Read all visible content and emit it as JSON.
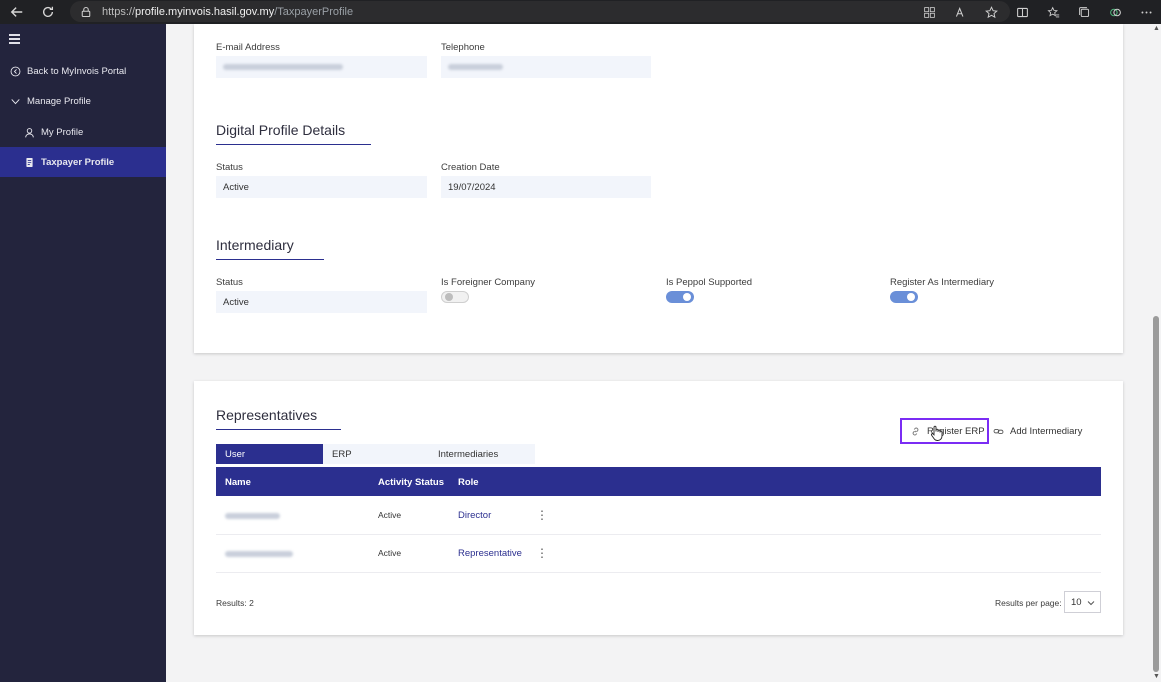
{
  "browser": {
    "url_prefix": "https://",
    "url_domain": "profile.myinvois.hasil.gov.my",
    "url_path": "/TaxpayerProfile"
  },
  "sidebar": {
    "items": [
      {
        "label": "Back to MyInvois Portal",
        "icon": "arrow-circle-left-icon"
      },
      {
        "label": "Manage Profile",
        "icon": "chevron-down-icon"
      },
      {
        "label": "My Profile",
        "icon": "user-icon"
      },
      {
        "label": "Taxpayer Profile",
        "icon": "document-icon",
        "active": true
      }
    ]
  },
  "contact": {
    "email_label": "E-mail Address",
    "telephone_label": "Telephone"
  },
  "digital_profile": {
    "title": "Digital Profile Details",
    "status_label": "Status",
    "status_value": "Active",
    "creation_date_label": "Creation Date",
    "creation_date_value": "19/07/2024"
  },
  "intermediary": {
    "title": "Intermediary",
    "status_label": "Status",
    "status_value": "Active",
    "foreigner_label": "Is Foreigner Company",
    "foreigner_on": false,
    "peppol_label": "Is Peppol Supported",
    "peppol_on": true,
    "register_label": "Register As Intermediary",
    "register_on": true
  },
  "representatives": {
    "title": "Representatives",
    "register_erp_label": "Register ERP",
    "add_intermediary_label": "Add Intermediary",
    "tabs": [
      "User",
      "ERP",
      "Intermediaries"
    ],
    "columns": [
      "Name",
      "Activity Status",
      "Role"
    ],
    "rows": [
      {
        "status": "Active",
        "role": "Director"
      },
      {
        "status": "Active",
        "role": "Representative"
      }
    ],
    "results_text": "Results: 2",
    "per_page_label": "Results per page:",
    "per_page_value": "10"
  },
  "colors": {
    "sidebar_bg": "#23243d",
    "accent": "#2b2f8f",
    "highlight": "#7b2cf4",
    "toggle_on": "#6a8fd8"
  }
}
